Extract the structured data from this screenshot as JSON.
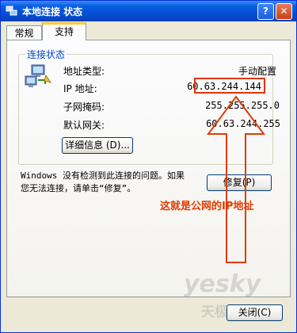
{
  "window": {
    "title": "本地连接 状态"
  },
  "tabs": [
    {
      "label": "常规"
    },
    {
      "label": "支持"
    }
  ],
  "connection_status": {
    "group_title": "连接状态",
    "rows": [
      {
        "label": "地址类型:",
        "value": "手动配置"
      },
      {
        "label": "IP 地址:",
        "value": "60.63.244.144"
      },
      {
        "label": "子网掩码:",
        "value": "255.255.255.0"
      },
      {
        "label": "默认网关:",
        "value": "60.63.244.255"
      }
    ],
    "details_button": "详细信息 (D)..."
  },
  "repair": {
    "message_line1": "Windows 没有检测到此连接的问题。如果",
    "message_line2": "您无法连接，请单击“修复”。",
    "button": "修复(P)"
  },
  "annotation": "这就是公网的IP地址",
  "close_button": "关闭(C)",
  "watermark": {
    "line1": "yesky",
    "line2": "天极网"
  },
  "colors": {
    "annotation": "#e03c00",
    "titlebar": "#0451d8",
    "group_title": "#0046d5"
  }
}
